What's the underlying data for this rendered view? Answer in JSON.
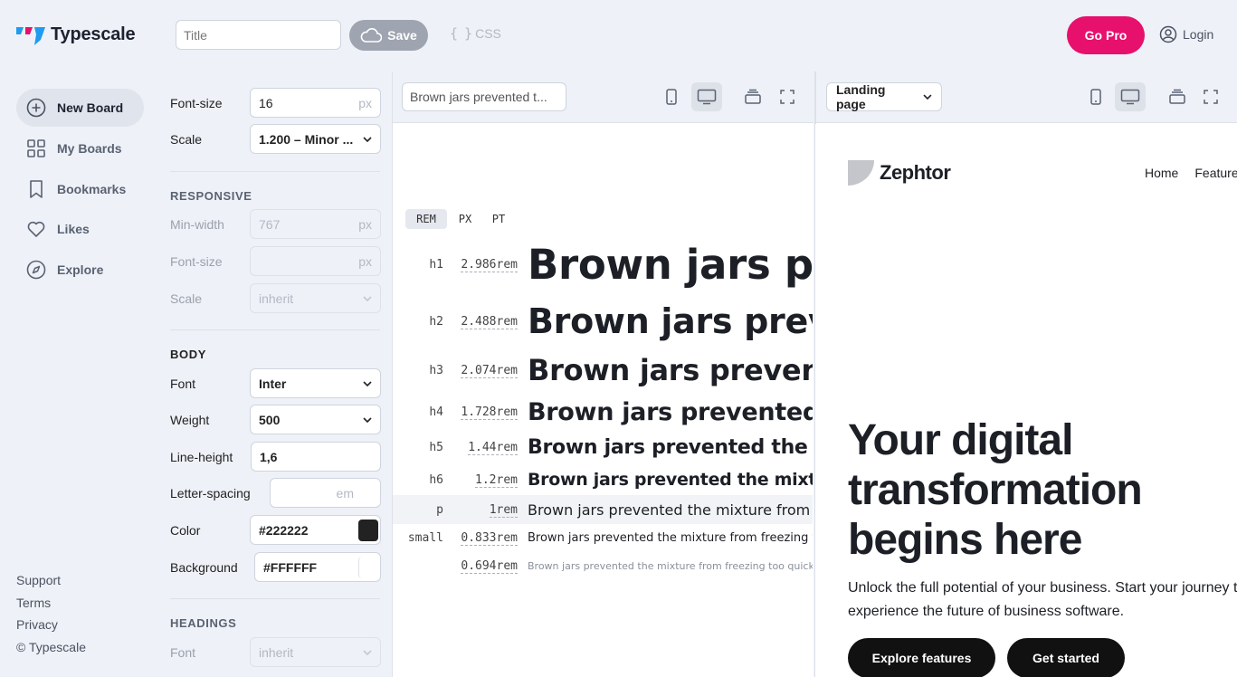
{
  "header": {
    "app_name": "Typescale",
    "title_placeholder": "Title",
    "save_label": "Save",
    "css_label": "CSS",
    "go_pro_label": "Go Pro",
    "login_label": "Login"
  },
  "nav": {
    "items": [
      {
        "label": "New Board",
        "icon": "plus-circle-icon",
        "active": true
      },
      {
        "label": "My Boards",
        "icon": "grid-icon"
      },
      {
        "label": "Bookmarks",
        "icon": "bookmark-icon"
      },
      {
        "label": "Likes",
        "icon": "heart-icon"
      },
      {
        "label": "Explore",
        "icon": "compass-icon"
      }
    ],
    "footer": [
      "Support",
      "Terms",
      "Privacy",
      "© Typescale"
    ]
  },
  "settings": {
    "font_size_label": "Font-size",
    "font_size_value": "16",
    "unit_px": "px",
    "scale_label": "Scale",
    "scale_value": "1.200 – Minor ...",
    "responsive": {
      "title": "RESPONSIVE",
      "min_width_label": "Min-width",
      "min_width_value": "767",
      "font_size_label": "Font-size",
      "scale_label": "Scale",
      "scale_value": "inherit"
    },
    "body": {
      "title": "BODY",
      "font_label": "Font",
      "font_value": "Inter",
      "weight_label": "Weight",
      "weight_value": "500",
      "line_height_label": "Line-height",
      "line_height_value": "1,6",
      "letter_spacing_label": "Letter-spacing",
      "letter_spacing_unit": "em",
      "color_label": "Color",
      "color_value": "#222222",
      "background_label": "Background",
      "background_value": "#FFFFFF"
    },
    "headings": {
      "title": "HEADINGS",
      "font_label": "Font",
      "font_value": "inherit"
    }
  },
  "scale_panel": {
    "sample_text_value": "Brown jars prevented t...",
    "unit_tabs": [
      "REM",
      "PX",
      "PT"
    ],
    "active_unit": "REM",
    "rows": [
      {
        "tag": "h1",
        "size": "2.986rem",
        "text": "Brown jars prevented the mixture from freezing too quickly"
      },
      {
        "tag": "h2",
        "size": "2.488rem",
        "text": "Brown jars prevented the mixture from freezing too quickly"
      },
      {
        "tag": "h3",
        "size": "2.074rem",
        "text": "Brown jars prevented the mixture from freezing too quickly"
      },
      {
        "tag": "h4",
        "size": "1.728rem",
        "text": "Brown jars prevented the mixture from freezing too quickly"
      },
      {
        "tag": "h5",
        "size": "1.44rem",
        "text": "Brown jars prevented the mixture from freezing too quickly"
      },
      {
        "tag": "h6",
        "size": "1.2rem",
        "text": "Brown jars prevented the mixture from freezing too quickly"
      },
      {
        "tag": "p",
        "size": "1rem",
        "text": "Brown jars prevented the mixture from freezing too quickly"
      },
      {
        "tag": "small",
        "size": "0.833rem",
        "text": "Brown jars prevented the mixture from freezing too quickly"
      },
      {
        "tag": "",
        "size": "0.694rem",
        "text": "Brown jars prevented the mixture from freezing too quickly"
      }
    ]
  },
  "landing_panel": {
    "template_value": "Landing page",
    "brand": "Zephtor",
    "nav_links": [
      "Home",
      "Features"
    ],
    "hero_title": "Your digital transformation begins here",
    "hero_subtitle": "Unlock the full potential of your business. Start your journey today and experience the future of business software.",
    "primary_cta": "Explore features",
    "secondary_cta": "Get started"
  },
  "colors": {
    "accent": "#e7106d",
    "logo_blue": "#1f9bf0",
    "body_color": "#222222",
    "background": "#FFFFFF"
  }
}
